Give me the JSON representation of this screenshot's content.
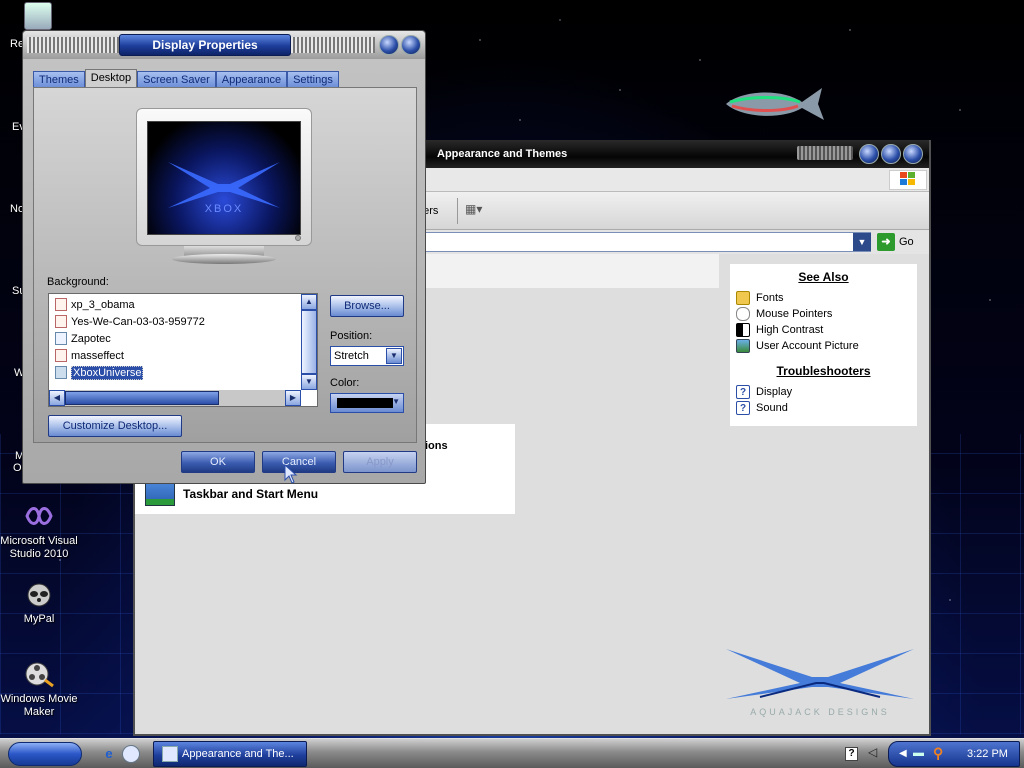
{
  "desktop": {
    "icons": [
      {
        "label": "Microsoft Visual Studio 2010"
      },
      {
        "label": "MyPal"
      },
      {
        "label": "Windows Movie Maker"
      }
    ],
    "edge_labels": [
      "Re",
      "Ev",
      "No",
      "Su",
      "W",
      "M",
      "O"
    ]
  },
  "explorer": {
    "title": "Appearance and Themes",
    "toolbar": {
      "folders_label": "ders"
    },
    "address": {
      "go_label": "Go"
    },
    "see_also": {
      "heading": "See Also",
      "items": [
        {
          "label": "Fonts",
          "icon": "folder-icon"
        },
        {
          "label": "Mouse Pointers",
          "icon": "mouse-icon"
        },
        {
          "label": "High Contrast",
          "icon": "contrast-icon"
        },
        {
          "label": "User Account Picture",
          "icon": "picture-icon"
        }
      ]
    },
    "troubleshooters": {
      "heading": "Troubleshooters",
      "items": [
        {
          "label": "Display",
          "icon": "help-icon"
        },
        {
          "label": "Sound",
          "icon": "help-icon"
        }
      ]
    },
    "tasks": {
      "partial_label": "ions",
      "taskbar_label": "Taskbar and Start Menu"
    },
    "brand_text": "AQUAJACK DESIGNS"
  },
  "dialog": {
    "title": "Display Properties",
    "tabs": [
      {
        "label": "Themes",
        "active": false
      },
      {
        "label": "Desktop",
        "active": true
      },
      {
        "label": "Screen Saver",
        "active": false
      },
      {
        "label": "Appearance",
        "active": false
      },
      {
        "label": "Settings",
        "active": false
      }
    ],
    "preview_logo": "XBOX",
    "background_label": "Background:",
    "backgrounds": [
      {
        "label": "xp_3_obama",
        "selected": false
      },
      {
        "label": "Yes-We-Can-03-03-959772",
        "selected": false
      },
      {
        "label": "Zapotec",
        "selected": false
      },
      {
        "label": "masseffect",
        "selected": false
      },
      {
        "label": "XboxUniverse",
        "selected": true
      }
    ],
    "browse_label": "Browse...",
    "position_label": "Position:",
    "position_value": "Stretch",
    "color_label": "Color:",
    "color_value": "#000000",
    "customize_label": "Customize Desktop...",
    "ok_label": "OK",
    "cancel_label": "Cancel",
    "apply_label": "Apply"
  },
  "taskbar": {
    "task_label": "Appearance and The...",
    "clock": "3:22 PM",
    "help_glyph": "?"
  }
}
